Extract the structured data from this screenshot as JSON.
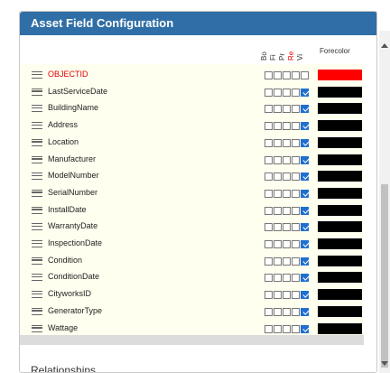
{
  "panel": {
    "title": "Asset Field Configuration"
  },
  "columns": {
    "checkbox_headers": [
      "Bo",
      "Fi",
      "Pr",
      "Re",
      "Vi"
    ],
    "forecolor_label": "Forecolor"
  },
  "colors": {
    "header_bg": "#2f6ea6",
    "grid_bg": "#fffff0",
    "required_red": "#e00000",
    "swatch_red": "#ff0000",
    "swatch_black": "#000000",
    "check_blue": "#1f6fd0"
  },
  "fields": [
    {
      "name": "OBJECTID",
      "required": true,
      "checks": [
        false,
        false,
        false,
        false,
        false
      ],
      "forecolor": "#ff0000"
    },
    {
      "name": "LastServiceDate",
      "required": false,
      "checks": [
        false,
        false,
        false,
        false,
        true
      ],
      "forecolor": "#000000"
    },
    {
      "name": "BuildingName",
      "required": false,
      "checks": [
        false,
        false,
        false,
        false,
        true
      ],
      "forecolor": "#000000"
    },
    {
      "name": "Address",
      "required": false,
      "checks": [
        false,
        false,
        false,
        false,
        true
      ],
      "forecolor": "#000000"
    },
    {
      "name": "Location",
      "required": false,
      "checks": [
        false,
        false,
        false,
        false,
        true
      ],
      "forecolor": "#000000"
    },
    {
      "name": "Manufacturer",
      "required": false,
      "checks": [
        false,
        false,
        false,
        false,
        true
      ],
      "forecolor": "#000000"
    },
    {
      "name": "ModelNumber",
      "required": false,
      "checks": [
        false,
        false,
        false,
        false,
        true
      ],
      "forecolor": "#000000"
    },
    {
      "name": "SerialNumber",
      "required": false,
      "checks": [
        false,
        false,
        false,
        false,
        true
      ],
      "forecolor": "#000000"
    },
    {
      "name": "InstallDate",
      "required": false,
      "checks": [
        false,
        false,
        false,
        false,
        true
      ],
      "forecolor": "#000000"
    },
    {
      "name": "WarrantyDate",
      "required": false,
      "checks": [
        false,
        false,
        false,
        false,
        true
      ],
      "forecolor": "#000000"
    },
    {
      "name": "InspectionDate",
      "required": false,
      "checks": [
        false,
        false,
        false,
        false,
        true
      ],
      "forecolor": "#000000"
    },
    {
      "name": "Condition",
      "required": false,
      "checks": [
        false,
        false,
        false,
        false,
        true
      ],
      "forecolor": "#000000"
    },
    {
      "name": "ConditionDate",
      "required": false,
      "checks": [
        false,
        false,
        false,
        false,
        true
      ],
      "forecolor": "#000000"
    },
    {
      "name": "CityworksID",
      "required": false,
      "checks": [
        false,
        false,
        false,
        false,
        true
      ],
      "forecolor": "#000000"
    },
    {
      "name": "GeneratorType",
      "required": false,
      "checks": [
        false,
        false,
        false,
        false,
        true
      ],
      "forecolor": "#000000"
    },
    {
      "name": "Wattage",
      "required": false,
      "checks": [
        false,
        false,
        false,
        false,
        true
      ],
      "forecolor": "#000000"
    }
  ],
  "sections": {
    "relationships_label": "Relationships"
  }
}
